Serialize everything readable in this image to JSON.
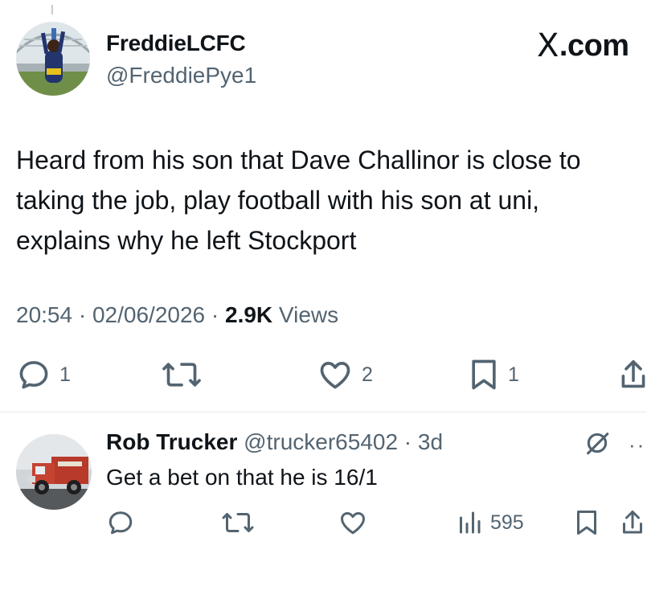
{
  "tweet": {
    "author": {
      "display_name": "FreddieLCFC",
      "handle": "@FreddiePye1",
      "avatar": "profile-photo"
    },
    "brand": {
      "logo": "X",
      "label": ".com"
    },
    "text_lines": [
      "Heard from his son that Dave Challinor is close to",
      "taking the job, play football with his son at uni,",
      "explains why he left Stockport"
    ],
    "meta": {
      "time": "20:54",
      "sep1": " · ",
      "date": "02/06/2026",
      "sep2": " · ",
      "views_count": "2.9K",
      "views_label": " Views"
    },
    "actions": {
      "replies": "1",
      "retweets": "",
      "likes": "2",
      "bookmarks": "1"
    }
  },
  "reply": {
    "author": {
      "display_name": "Rob Trucker",
      "handle": "@trucker65402",
      "sep": " · ",
      "time": "3d",
      "avatar": "truck-photo"
    },
    "text": "Get a bet on that he is 16/1",
    "actions": {
      "views": "595"
    }
  },
  "icons": {
    "reply": "comment-icon",
    "retweet": "retweet-icon",
    "like": "heart-icon",
    "bookmark": "bookmark-icon",
    "share": "share-icon",
    "views": "analytics-icon",
    "grok": "grok-icon",
    "more": "more-icon"
  },
  "colors": {
    "text": "#0f1419",
    "secondary": "#536471",
    "divider": "#e7e9ea"
  }
}
